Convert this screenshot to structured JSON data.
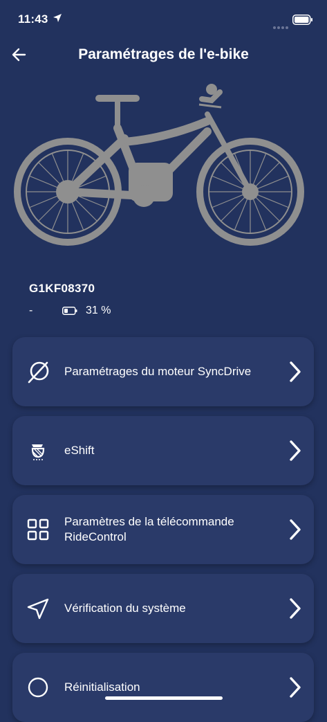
{
  "status_bar": {
    "time": "11:43"
  },
  "nav": {
    "title": "Paramétrages de l'e-bike"
  },
  "bike": {
    "serial": "G1KF08370",
    "status": "-",
    "battery_percent": "31 %"
  },
  "menu": [
    {
      "label": "Paramétrages du moteur SyncDrive",
      "icon": "motor-icon"
    },
    {
      "label": "eShift",
      "icon": "eshift-icon"
    },
    {
      "label": "Paramètres de la télécommande RideControl",
      "icon": "grid-icon"
    },
    {
      "label": "Vérification du système",
      "icon": "navigation-arrow-icon"
    },
    {
      "label": "Réinitialisation",
      "icon": "reset-icon"
    }
  ]
}
